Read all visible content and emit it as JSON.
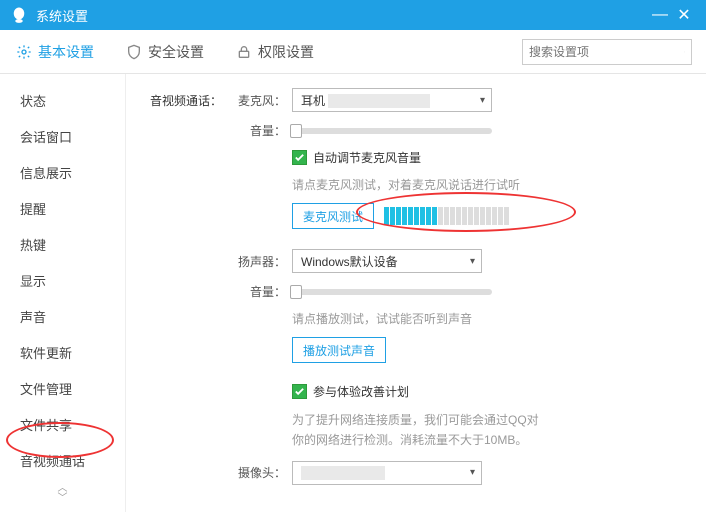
{
  "titlebar": {
    "title": "系统设置"
  },
  "tabs": {
    "basic": "基本设置",
    "security": "安全设置",
    "privacy": "权限设置"
  },
  "search": {
    "placeholder": "搜索设置项"
  },
  "sidebar": {
    "items": [
      "状态",
      "会话窗口",
      "信息展示",
      "提醒",
      "热键",
      "显示",
      "声音",
      "软件更新",
      "文件管理",
      "文件共享",
      "音视频通话"
    ]
  },
  "main": {
    "section_label": "音视频通话：",
    "mic_label": "麦克风：",
    "mic_value": "耳机",
    "volume_label": "音量：",
    "auto_mic": "自动调节麦克风音量",
    "mic_hint": "请点麦克风测试，对着麦克风说话进行试听",
    "mic_test_btn": "麦克风测试",
    "vu_level": 9,
    "vu_total": 21,
    "speaker_label": "扬声器：",
    "speaker_value": "Windows默认设备",
    "speaker_hint": "请点播放测试，试试能否听到声音",
    "speaker_test_btn": "播放测试声音",
    "feedback_check": "参与体验改善计划",
    "feedback_hint": "为了提升网络连接质量，我们可能会通过QQ对你的网络进行检测。消耗流量不大于10MB。",
    "camera_label": "摄像头："
  }
}
